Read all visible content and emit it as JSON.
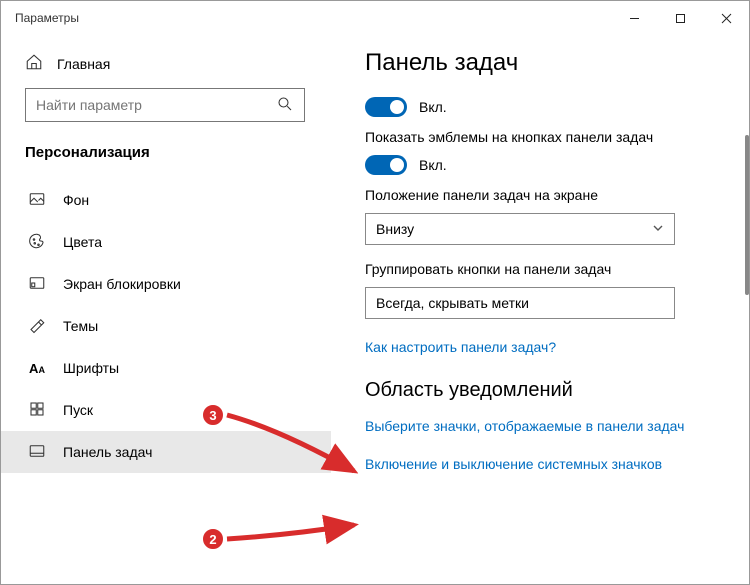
{
  "window": {
    "title": "Параметры"
  },
  "sidebar": {
    "home_label": "Главная",
    "search_placeholder": "Найти параметр",
    "section_title": "Персонализация",
    "items": [
      {
        "label": "Фон"
      },
      {
        "label": "Цвета"
      },
      {
        "label": "Экран блокировки"
      },
      {
        "label": "Темы"
      },
      {
        "label": "Шрифты"
      },
      {
        "label": "Пуск"
      },
      {
        "label": "Панель задач"
      }
    ]
  },
  "main": {
    "page_title": "Панель задач",
    "toggle1_label": "Вкл.",
    "setting2_label": "Показать эмблемы на кнопках панели задач",
    "toggle2_label": "Вкл.",
    "setting3_label": "Положение панели задач на экране",
    "dropdown_value": "Внизу",
    "setting4_label": "Группировать кнопки на панели задач",
    "textbox_value": "Всегда, скрывать метки",
    "help_link": "Как настроить панели задач?",
    "subheading": "Область уведомлений",
    "link1": "Выберите значки, отображаемые в панели задач",
    "link2": "Включение и выключение системных значков"
  },
  "annotations": {
    "badge3": "3",
    "badge2": "2"
  }
}
